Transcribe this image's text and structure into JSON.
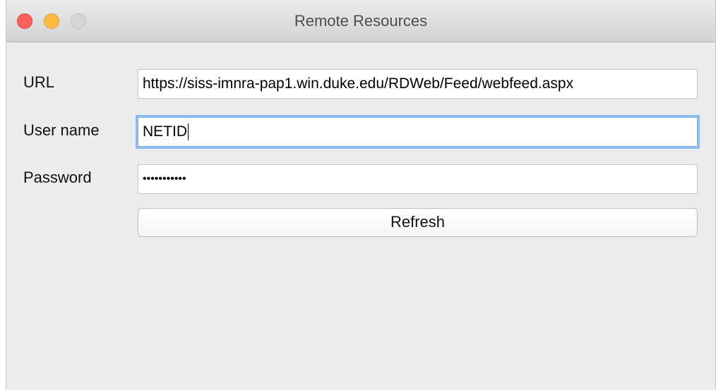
{
  "window": {
    "title": "Remote Resources"
  },
  "form": {
    "url_label": "URL",
    "url_value": "https://siss-imnra-pap1.win.duke.edu/RDWeb/Feed/webfeed.aspx",
    "username_label": "User name",
    "username_value": "NETID",
    "password_label": "Password",
    "password_value": "•••••••••••",
    "refresh_label": "Refresh"
  },
  "colors": {
    "close": "#fc605c",
    "minimize": "#fdbc40",
    "zoom_disabled": "#d6d6d6",
    "focus_ring": "#8ebcf0"
  },
  "icons": {
    "close": "close-window-icon",
    "minimize": "minimize-window-icon",
    "zoom": "zoom-window-icon"
  }
}
